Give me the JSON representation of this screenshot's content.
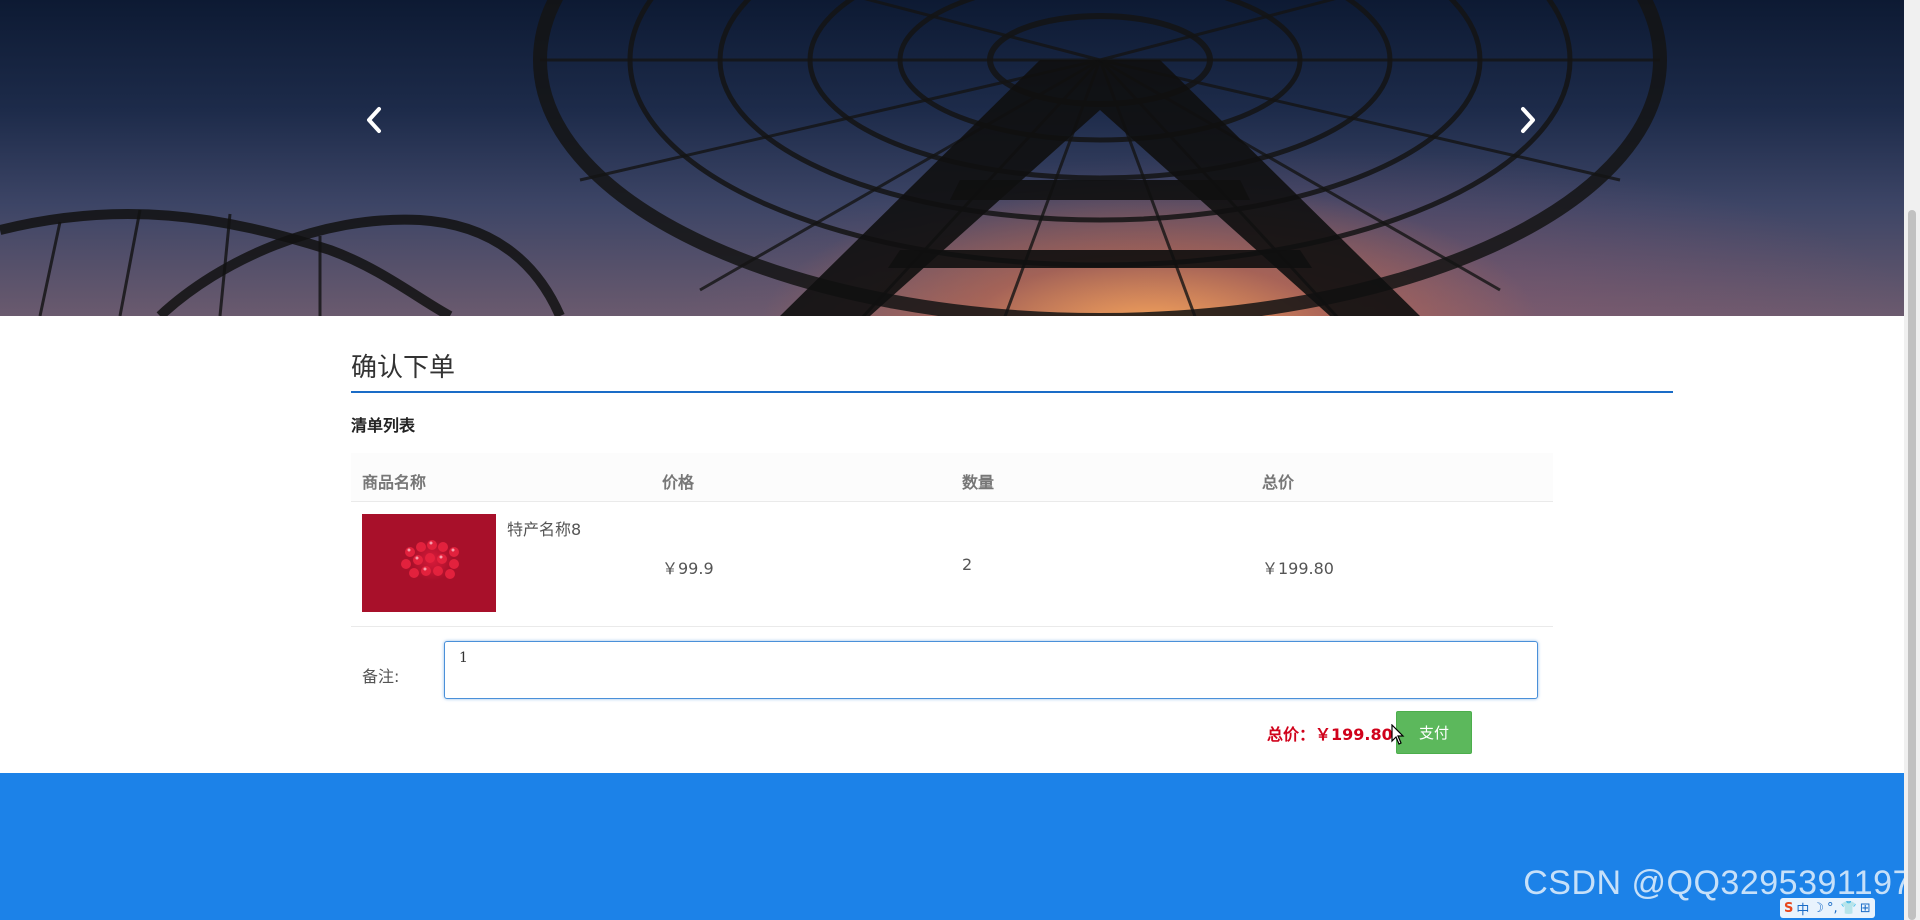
{
  "banner": {
    "prev_icon": "chevron-left-icon",
    "next_icon": "chevron-right-icon"
  },
  "page": {
    "title": "确认下单",
    "section_title": "清单列表"
  },
  "table": {
    "headers": [
      "商品名称",
      "价格",
      "数量",
      "总价"
    ],
    "rows": [
      {
        "name": "特产名称8",
        "price": "￥99.9",
        "quantity": "2",
        "total": "￥199.80"
      }
    ]
  },
  "notes": {
    "label": "备注:",
    "value": "1"
  },
  "order": {
    "total_label": "总价：￥199.80",
    "pay_button": "支付"
  },
  "footer": {
    "watermark": "CSDN @QQ3295391197"
  },
  "ime": {
    "items": [
      "S",
      "中",
      "☽",
      "°,",
      "👕",
      "⊞"
    ]
  },
  "colors": {
    "accent": "#1a6cc7",
    "footer": "#1c82e8",
    "pay_button": "#5cb85c",
    "total_text": "#d0021b"
  }
}
